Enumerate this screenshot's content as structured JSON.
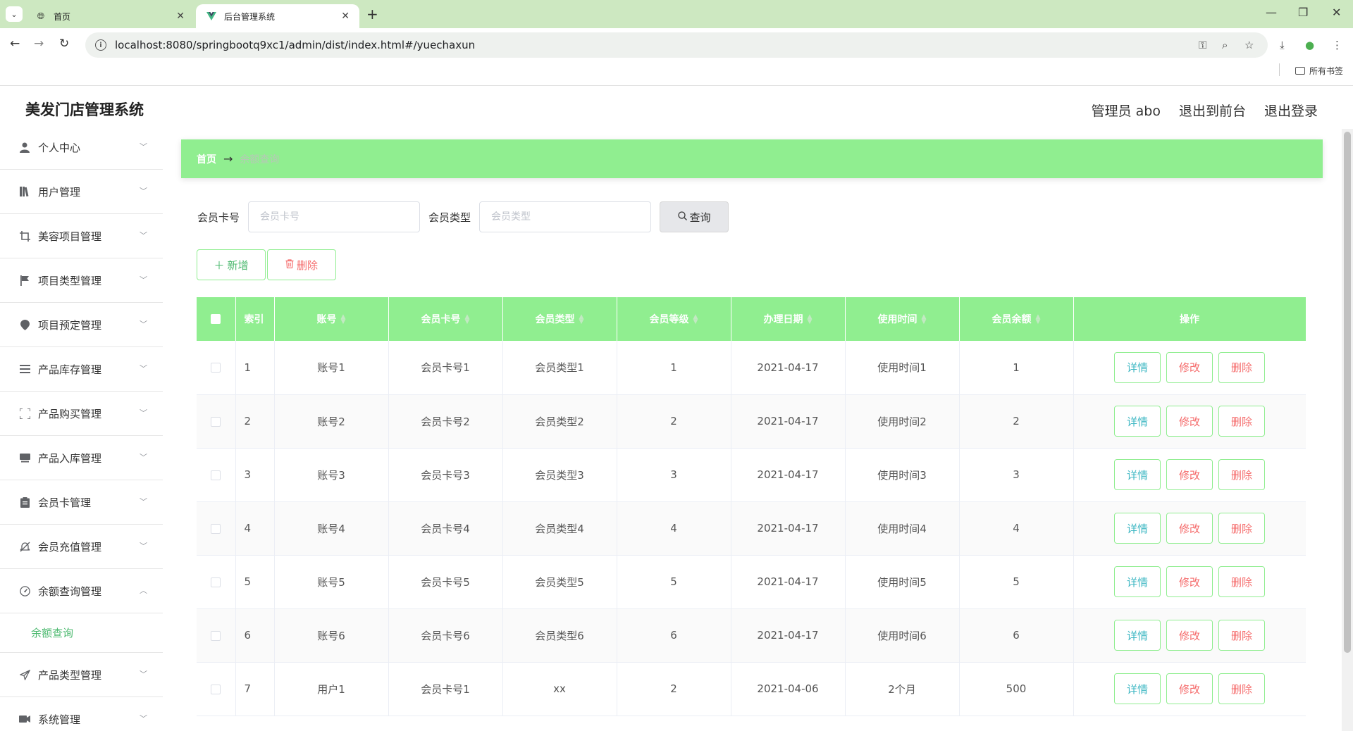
{
  "browser": {
    "tabs": [
      {
        "title": "首页",
        "icon": "globe-icon"
      },
      {
        "title": "后台管理系统",
        "icon": "vue-logo-icon"
      }
    ],
    "url": "localhost:8080/springbootq9xc1/admin/dist/index.html#/yuechaxun",
    "bookmarks_label": "所有书签"
  },
  "header": {
    "title": "美发门店管理系统",
    "user": "管理员 abo",
    "to_front": "退出到前台",
    "logout": "退出登录"
  },
  "sidebar": {
    "items": [
      {
        "label": "个人中心",
        "icon": "person-icon"
      },
      {
        "label": "用户管理",
        "icon": "library-icon"
      },
      {
        "label": "美容项目管理",
        "icon": "crop-icon"
      },
      {
        "label": "项目类型管理",
        "icon": "flag-icon"
      },
      {
        "label": "项目预定管理",
        "icon": "marker-icon"
      },
      {
        "label": "产品库存管理",
        "icon": "list-icon"
      },
      {
        "label": "产品购买管理",
        "icon": "fullscreen-icon"
      },
      {
        "label": "产品入库管理",
        "icon": "inbox-icon"
      },
      {
        "label": "会员卡管理",
        "icon": "clipboard-icon"
      },
      {
        "label": "会员充值管理",
        "icon": "bell-off-icon"
      },
      {
        "label": "余额查询管理",
        "icon": "odometer-icon"
      },
      {
        "label": "产品类型管理",
        "icon": "send-icon"
      },
      {
        "label": "系统管理",
        "icon": "camera-icon"
      }
    ],
    "active_sub": "余额查询"
  },
  "breadcrumb": {
    "home": "首页",
    "current": "余额查询"
  },
  "search": {
    "card_label": "会员卡号",
    "card_placeholder": "会员卡号",
    "type_label": "会员类型",
    "type_placeholder": "会员类型",
    "query_btn": "查询"
  },
  "actions": {
    "add": "新增",
    "delete": "删除"
  },
  "table": {
    "columns": [
      "索引",
      "账号",
      "会员卡号",
      "会员类型",
      "会员等级",
      "办理日期",
      "使用时间",
      "会员余额",
      "操作"
    ],
    "rows": [
      {
        "idx": "1",
        "account": "账号1",
        "card": "会员卡号1",
        "type": "会员类型1",
        "level": "1",
        "date": "2021-04-17",
        "time": "使用时间1",
        "balance": "1"
      },
      {
        "idx": "2",
        "account": "账号2",
        "card": "会员卡号2",
        "type": "会员类型2",
        "level": "2",
        "date": "2021-04-17",
        "time": "使用时间2",
        "balance": "2"
      },
      {
        "idx": "3",
        "account": "账号3",
        "card": "会员卡号3",
        "type": "会员类型3",
        "level": "3",
        "date": "2021-04-17",
        "time": "使用时间3",
        "balance": "3"
      },
      {
        "idx": "4",
        "account": "账号4",
        "card": "会员卡号4",
        "type": "会员类型4",
        "level": "4",
        "date": "2021-04-17",
        "time": "使用时间4",
        "balance": "4"
      },
      {
        "idx": "5",
        "account": "账号5",
        "card": "会员卡号5",
        "type": "会员类型5",
        "level": "5",
        "date": "2021-04-17",
        "time": "使用时间5",
        "balance": "5"
      },
      {
        "idx": "6",
        "account": "账号6",
        "card": "会员卡号6",
        "type": "会员类型6",
        "level": "6",
        "date": "2021-04-17",
        "time": "使用时间6",
        "balance": "6"
      },
      {
        "idx": "7",
        "account": "用户1",
        "card": "会员卡号1",
        "type": "xx",
        "level": "2",
        "date": "2021-04-06",
        "time": "2个月",
        "balance": "500"
      }
    ],
    "op_view": "详情",
    "op_edit": "修改",
    "op_delete": "删除"
  },
  "colors": {
    "accent_green": "#90ee90",
    "text_green": "#4cb96f",
    "danger": "#f56c6c",
    "info": "#40b8c4",
    "tabbar": "#cde8c1"
  }
}
